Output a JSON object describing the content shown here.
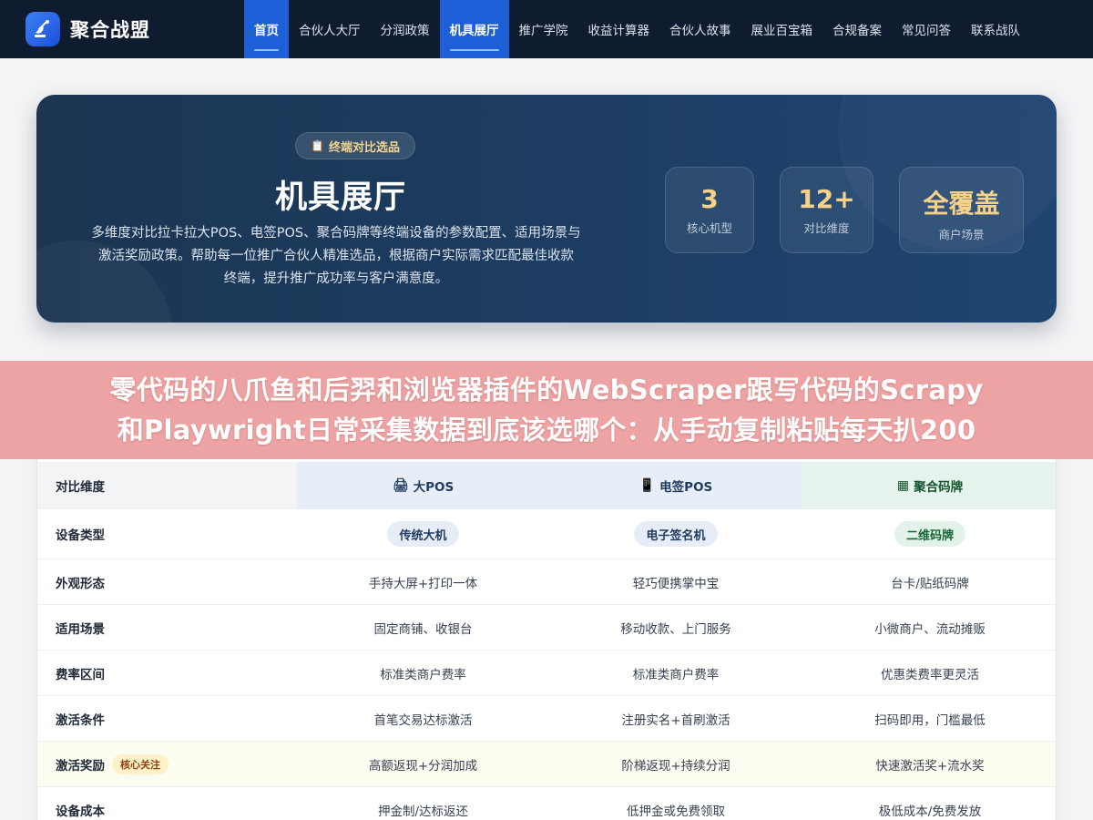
{
  "brand": {
    "name": "聚合战盟",
    "logo_icon": "satellite-dish-icon"
  },
  "nav": {
    "items": [
      {
        "label": "首页",
        "active": true
      },
      {
        "label": "合伙人大厅",
        "active": false
      },
      {
        "label": "分润政策",
        "active": false
      },
      {
        "label": "机具展厅",
        "active": true
      },
      {
        "label": "推广学院",
        "active": false
      },
      {
        "label": "收益计算器",
        "active": false
      },
      {
        "label": "合伙人故事",
        "active": false
      },
      {
        "label": "展业百宝箱",
        "active": false
      },
      {
        "label": "合规备案",
        "active": false
      },
      {
        "label": "常见问答",
        "active": false
      },
      {
        "label": "联系战队",
        "active": false
      }
    ]
  },
  "hero": {
    "badge": "终端对比选品",
    "badge_icon": "clipboard-icon",
    "title": "机具展厅",
    "description_lines": [
      "多维度对比拉卡拉大POS、电签POS、聚合码牌等终端设备的参数配置、适用场景与",
      "激活奖励政策。帮助每一位推广合伙人精准选品，根据商户实际需求匹配最佳收款",
      "终端，提升推广成功率与客户满意度。"
    ],
    "stats": [
      {
        "value": "3",
        "label": "核心机型"
      },
      {
        "value": "12+",
        "label": "对比维度"
      },
      {
        "value": "全覆盖",
        "label": "商户场景"
      }
    ]
  },
  "banner": {
    "lines": [
      "零代码的八爪鱼和后羿和浏览器插件的WebScraper跟写代码的Scrapy",
      "和Playwright日常采集数据到底该选哪个：从手动复制粘贴每天扒200"
    ]
  },
  "table": {
    "header": {
      "first": "对比维度",
      "columns": [
        {
          "label": "大POS",
          "icon": "printer-icon"
        },
        {
          "label": "电签POS",
          "icon": "mobile-phone-icon"
        },
        {
          "label": "聚合码牌",
          "icon": "qr-sign-icon"
        }
      ]
    },
    "rows": [
      {
        "label": "设备类型",
        "values": [
          "传统大机",
          "电子签名机",
          "二维码牌"
        ],
        "chips": true
      },
      {
        "label": "外观形态",
        "values": [
          "手持大屏+打印一体",
          "轻巧便携掌中宝",
          "台卡/贴纸码牌"
        ]
      },
      {
        "label": "适用场景",
        "values": [
          "固定商铺、收银台",
          "移动收款、上门服务",
          "小微商户、流动摊贩"
        ]
      },
      {
        "label": "费率区间",
        "values": [
          "标准类商户费率",
          "标准类商户费率",
          "优惠类费率更灵活"
        ]
      },
      {
        "label": "激活条件",
        "values": [
          "首笔交易达标激活",
          "注册实名+首刷激活",
          "扫码即用，门槛最低"
        ]
      },
      {
        "label": "激活奖励",
        "tag": "核心关注",
        "values": [
          "高额返现+分润加成",
          "阶梯返现+持续分润",
          "快速激活奖+流水奖"
        ],
        "highlight": true
      },
      {
        "label": "设备成本",
        "values": [
          "押金制/达标返还",
          "低押金或免费领取",
          "极低成本/免费发放"
        ]
      }
    ]
  },
  "colors": {
    "nav_bg": "#0f1b2e",
    "nav_active": "#1e5fd8",
    "hero_bg": "#1d3d63",
    "stat_accent": "#f6d289",
    "banner": "#ec9797"
  }
}
